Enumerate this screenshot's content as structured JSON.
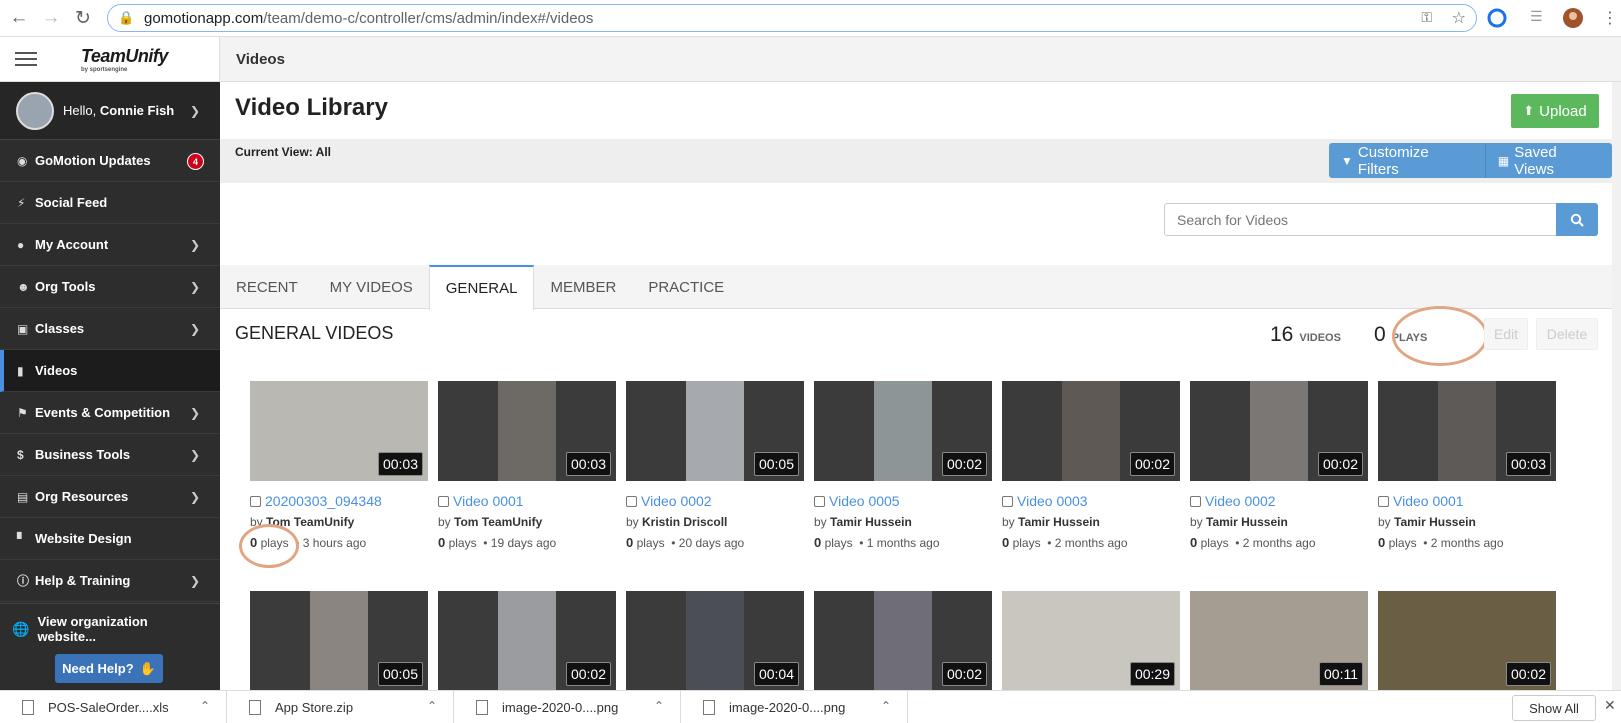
{
  "browser": {
    "url_host": "gomotionapp.com",
    "url_path": "/team/demo-c/controller/cms/admin/index#/videos"
  },
  "sidebar": {
    "logo_text": "TeamUnify",
    "logo_sub": "by sportsengine",
    "greeting": "Hello, ",
    "user_name": "Connie Fish",
    "items": [
      {
        "label": "GoMotion Updates",
        "icon": "flame-icon",
        "badge": "4",
        "chevron": false
      },
      {
        "label": "Social Feed",
        "icon": "bolt-icon",
        "chevron": false
      },
      {
        "label": "My Account",
        "icon": "user-circle-icon",
        "chevron": true
      },
      {
        "label": "Org Tools",
        "icon": "users-icon",
        "chevron": true
      },
      {
        "label": "Classes",
        "icon": "calendar-icon",
        "chevron": true
      },
      {
        "label": "Videos",
        "icon": "video-camera-icon",
        "chevron": false,
        "active": true
      },
      {
        "label": "Events & Competition",
        "icon": "flag-icon",
        "chevron": true
      },
      {
        "label": "Business Tools",
        "icon": "dollar-icon",
        "chevron": true
      },
      {
        "label": "Org Resources",
        "icon": "document-icon",
        "chevron": true
      },
      {
        "label": "Website Design",
        "icon": "paint-roller-icon",
        "chevron": false
      },
      {
        "label": "Help & Training",
        "icon": "question-circle-icon",
        "chevron": true
      }
    ],
    "view_org": "View organization website...",
    "need_help": "Need Help?"
  },
  "header": {
    "section": "Videos"
  },
  "main": {
    "title": "Video Library",
    "upload_label": "Upload",
    "current_view": "Current View: All",
    "customize_filters": "Customize Filters",
    "saved_views": "Saved Views",
    "search_placeholder": "Search for Videos",
    "tabs": [
      "RECENT",
      "MY VIDEOS",
      "GENERAL",
      "MEMBER",
      "PRACTICE"
    ],
    "active_tab": "GENERAL",
    "section_title": "GENERAL VIDEOS",
    "videos_count": "16",
    "videos_label": "VIDEOS",
    "plays_count": "0",
    "plays_label": "PLAYS",
    "edit_label": "Edit",
    "delete_label": "Delete"
  },
  "videos": [
    {
      "title": "20200303_094348",
      "author": "Tom TeamUnify",
      "plays": "0",
      "plays_word": "plays",
      "age": "3 hours ago",
      "duration": "00:03",
      "thumb_color": "#b9b8b3"
    },
    {
      "title": "Video 0001",
      "author": "Tom TeamUnify",
      "plays": "0",
      "plays_word": "plays",
      "age": "19 days ago",
      "duration": "00:03",
      "thumb_color": "#6d6a66"
    },
    {
      "title": "Video 0002",
      "author": "Kristin Driscoll",
      "plays": "0",
      "plays_word": "plays",
      "age": "20 days ago",
      "duration": "00:05",
      "thumb_color": "#a6a9ad"
    },
    {
      "title": "Video 0005",
      "author": "Tamir Hussein",
      "plays": "0",
      "plays_word": "plays",
      "age": "1 months ago",
      "duration": "00:02",
      "thumb_color": "#8e9597"
    },
    {
      "title": "Video 0003",
      "author": "Tamir Hussein",
      "plays": "0",
      "plays_word": "plays",
      "age": "2 months ago",
      "duration": "00:02",
      "thumb_color": "#5e5955"
    },
    {
      "title": "Video 0002",
      "author": "Tamir Hussein",
      "plays": "0",
      "plays_word": "plays",
      "age": "2 months ago",
      "duration": "00:02",
      "thumb_color": "#7a7774"
    },
    {
      "title": "Video 0001",
      "author": "Tamir Hussein",
      "plays": "0",
      "plays_word": "plays",
      "age": "2 months ago",
      "duration": "00:03",
      "thumb_color": "#5d5a58"
    },
    {
      "duration": "00:05",
      "thumb_color": "#8a8580"
    },
    {
      "duration": "00:02",
      "thumb_color": "#9a9ca0"
    },
    {
      "duration": "00:04",
      "thumb_color": "#4b4e55"
    },
    {
      "duration": "00:02",
      "thumb_color": "#6e6d78"
    },
    {
      "duration": "00:29",
      "thumb_color": "#c9c6c0"
    },
    {
      "duration": "00:11",
      "thumb_color": "#a59d92"
    },
    {
      "duration": "00:02",
      "thumb_color": "#6a5e44"
    }
  ],
  "downloads": {
    "items": [
      "POS-SaleOrder....xls",
      "App Store.zip",
      "image-2020-0....png",
      "image-2020-0....png"
    ],
    "show_all": "Show All"
  },
  "colors": {
    "accent_blue": "#4a90e2",
    "upload_green": "#5cb85c",
    "filter_blue": "#5b9bd5",
    "sidebar_bg": "#2d2d2d",
    "annotation_circle": "#e2a583"
  }
}
